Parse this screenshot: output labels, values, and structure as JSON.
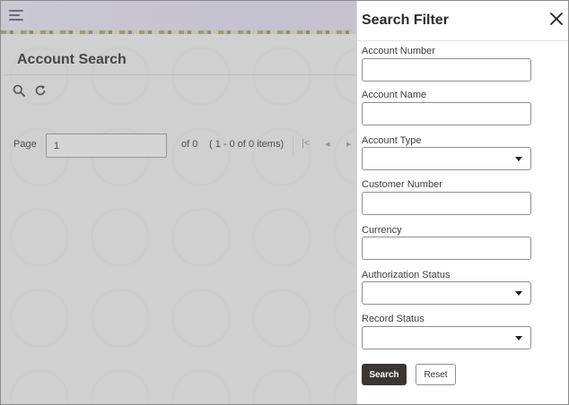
{
  "app": {
    "page_title": "Account Search",
    "pager": {
      "page_label": "Page",
      "page_value": "1",
      "of_text": "of 0",
      "items_text": "( 1 - 0 of 0 items)",
      "first_glyph": "|<",
      "prev_glyph": "◂",
      "next_glyph": "▸"
    }
  },
  "drawer": {
    "title": "Search Filter",
    "fields": {
      "account_number": {
        "label": "Account Number",
        "value": ""
      },
      "account_name": {
        "label": "Account Name",
        "value": ""
      },
      "account_type": {
        "label": "Account Type",
        "value": ""
      },
      "customer_number": {
        "label": "Customer Number",
        "value": ""
      },
      "currency": {
        "label": "Currency",
        "value": ""
      },
      "authorization_status": {
        "label": "Authorization Status",
        "value": ""
      },
      "record_status": {
        "label": "Record Status",
        "value": ""
      }
    },
    "buttons": {
      "search": "Search",
      "reset": "Reset"
    }
  },
  "icons": {
    "menu": "hamburger-icon",
    "search": "search-icon",
    "refresh": "refresh-icon",
    "close": "close-icon",
    "dropdown": "chevron-down-icon"
  },
  "colors": {
    "primary_button": "#3a3633",
    "drawer_bg": "#ffffff",
    "backdrop": "#e3e3e3"
  }
}
